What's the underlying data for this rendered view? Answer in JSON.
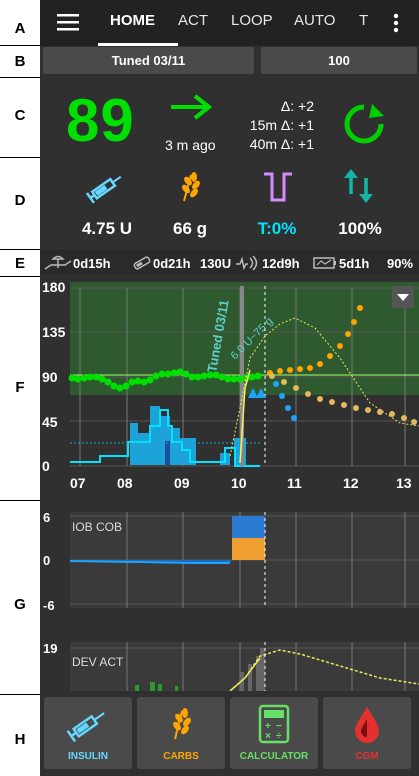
{
  "row_labels": [
    "A",
    "B",
    "C",
    "D",
    "E",
    "F",
    "G",
    "H"
  ],
  "topbar": {
    "tabs": [
      "HOME",
      "ACT",
      "LOOP",
      "AUTO",
      "T"
    ]
  },
  "profile": {
    "name": "Tuned 03/11",
    "percentage": "100"
  },
  "bg": {
    "value": "89",
    "age": "3 m ago",
    "delta": "Δ: +2",
    "delta15": "15m Δ: +1",
    "delta40": "40m Δ: +1"
  },
  "status": {
    "iob": "4.75 U",
    "cob": "66 g",
    "temp": "T:0%",
    "pct": "100%"
  },
  "device_status": {
    "cannula_age": "0d15h",
    "insulin_age": "0d21h",
    "insulin_units": "130U",
    "sensor_age": "12d9h",
    "battery_age": "5d1h",
    "battery_level": "90%"
  },
  "main_graph": {
    "y_ticks": [
      "180",
      "135",
      "90",
      "45",
      "0"
    ],
    "x_ticks": [
      "07",
      "08",
      "09",
      "10",
      "11",
      "12",
      "13"
    ],
    "annotation_profile": "Tuned 03/11",
    "annotation_carbs": "6.0 U~75 g"
  },
  "iob_graph": {
    "label": "IOB COB",
    "y_ticks": [
      "6",
      "0",
      "-6"
    ]
  },
  "dev_graph": {
    "label": "DEV ACT",
    "y_ticks": [
      "19"
    ]
  },
  "buttons": {
    "insulin": "INSULIN",
    "carbs": "CARBS",
    "calculator": "CALCULATOR",
    "cgm": "CGM"
  },
  "colors": {
    "bg_green": "#00e000",
    "iob_blue": "#1ea3ff",
    "carbs_orange": "#ffa500",
    "temp_cyan": "#00e5ff",
    "cgm_red": "#e53030"
  }
}
